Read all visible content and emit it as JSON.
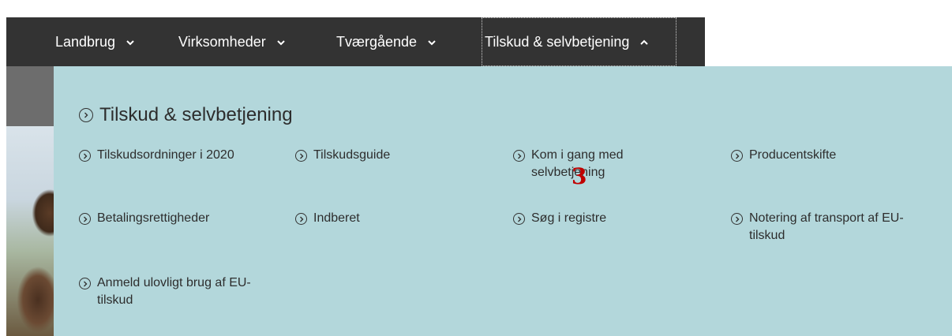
{
  "nav": {
    "items": [
      {
        "label": "Landbrug"
      },
      {
        "label": "Virksomheder"
      },
      {
        "label": "Tværgående"
      },
      {
        "label": "Tilskud & selvbetjening"
      }
    ]
  },
  "mega": {
    "title": "Tilskud & selvbetjening",
    "links": [
      {
        "label": "Tilskudsordninger i 2020"
      },
      {
        "label": "Tilskudsguide"
      },
      {
        "label": "Kom i gang med selvbetjening"
      },
      {
        "label": "Producentskifte"
      },
      {
        "label": "Betalingsrettigheder"
      },
      {
        "label": "Indberet"
      },
      {
        "label": "Søg i registre"
      },
      {
        "label": "Notering af transport af EU-tilskud"
      },
      {
        "label": "Anmeld ulovligt brug af EU-tilskud"
      }
    ]
  },
  "annotation": {
    "marker": "3"
  },
  "colors": {
    "navbar": "#333333",
    "panel": "#b3d7db",
    "marker": "#c00000"
  }
}
